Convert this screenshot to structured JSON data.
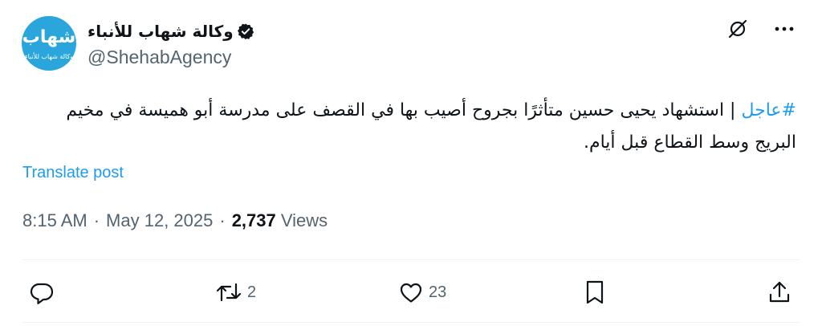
{
  "author": {
    "display_name": "وكالة شهاب للأنباء",
    "handle": "@ShehabAgency",
    "avatar_mark": "شهاب",
    "avatar_caption": "وكالة شهاب للأنباء",
    "verified": true
  },
  "post": {
    "hashtag": "#عاجل",
    "body": " | استشهاد يحيى حسين متأثرًا بجروح أصيب بها في القصف على مدرسة أبو هميسة في مخيم البريج وسط القطاع قبل أيام."
  },
  "translate_label": "Translate post",
  "meta": {
    "time": "8:15 AM",
    "separator1": "·",
    "date": "May 12, 2025",
    "separator2": "·",
    "views_count": "2,737",
    "views_label": "Views"
  },
  "actions": {
    "reply_count": "",
    "repost_count": "2",
    "like_count": "23"
  },
  "colors": {
    "accent": "#1d9bf0",
    "secondary_text": "#536471",
    "avatar_bg": "#2aa6dc"
  },
  "icons": [
    "grok-icon",
    "more-icon",
    "reply-icon",
    "repost-icon",
    "like-icon",
    "bookmark-icon",
    "share-icon",
    "verified-badge-icon"
  ]
}
